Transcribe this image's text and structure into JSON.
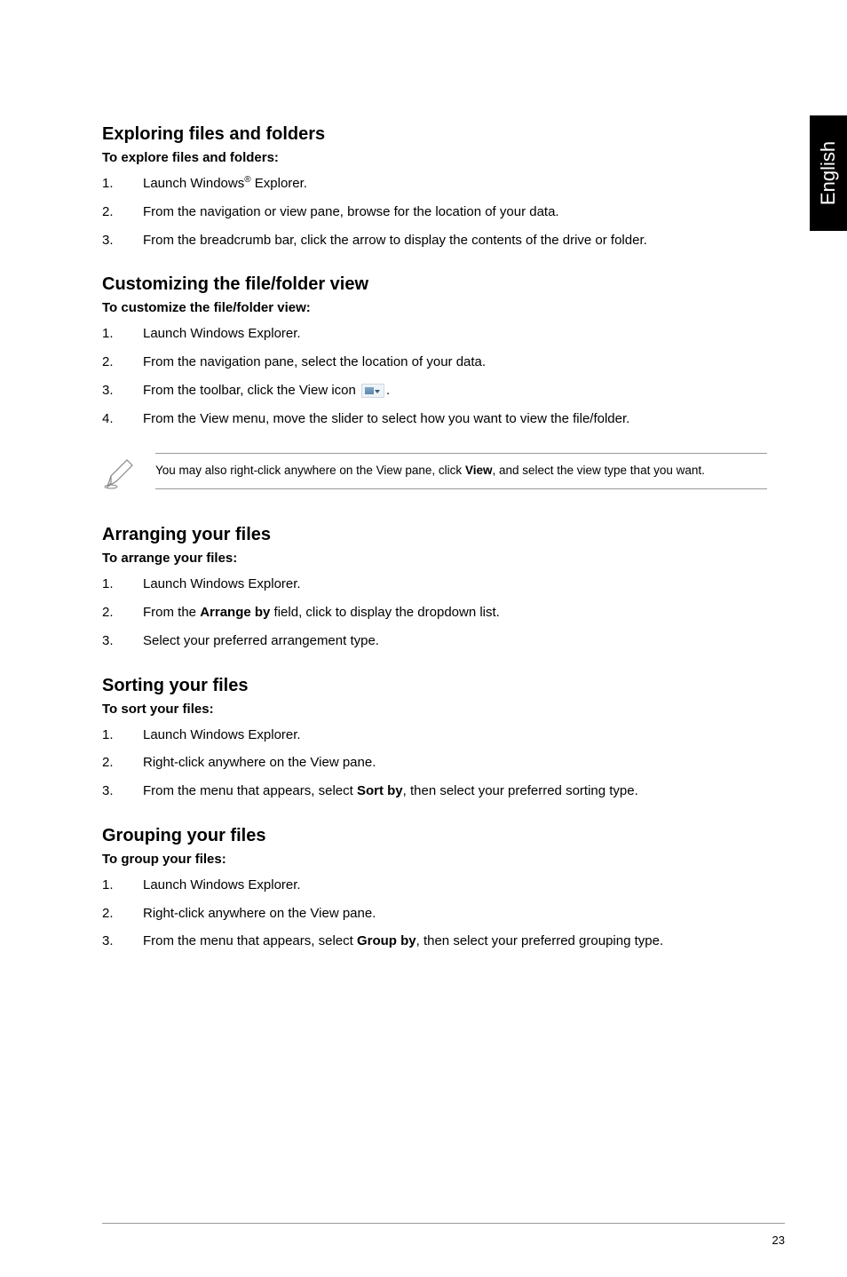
{
  "sideTab": "English",
  "sections": [
    {
      "heading": "Exploring files and folders",
      "subheading": "To explore files and folders:",
      "steps": [
        {
          "num": "1.",
          "pre": "Launch Windows",
          "sup": "®",
          "post": " Explorer."
        },
        {
          "num": "2.",
          "text": "From the navigation or view pane, browse for the location of your data."
        },
        {
          "num": "3.",
          "text": "From the breadcrumb bar, click the arrow to display the contents of the drive or folder."
        }
      ]
    },
    {
      "heading": "Customizing the file/folder view",
      "subheading": "To customize the file/folder view:",
      "steps": [
        {
          "num": "1.",
          "text": "Launch Windows Explorer."
        },
        {
          "num": "2.",
          "text": "From the navigation pane, select the location of your data."
        },
        {
          "num": "3.",
          "textBefore": "From the toolbar, click the View icon ",
          "hasViewIcon": true,
          "textAfter": "."
        },
        {
          "num": "4.",
          "text": "From the View menu, move the slider to select how you want to view the file/folder."
        }
      ],
      "note": {
        "pre": "You may also right-click anywhere on the View pane, click ",
        "bold": "View",
        "post": ", and select the view type that you want."
      }
    },
    {
      "heading": "Arranging your files",
      "subheading": "To arrange your files:",
      "steps": [
        {
          "num": "1.",
          "text": "Launch Windows Explorer."
        },
        {
          "num": "2.",
          "textBefore": "From the ",
          "bold": "Arrange by",
          "textAfter": " field, click to display the dropdown list."
        },
        {
          "num": "3.",
          "text": "Select your preferred arrangement type."
        }
      ]
    },
    {
      "heading": "Sorting your files",
      "subheading": "To sort your files:",
      "steps": [
        {
          "num": "1.",
          "text": "Launch Windows Explorer."
        },
        {
          "num": "2.",
          "text": "Right-click anywhere on the View pane."
        },
        {
          "num": "3.",
          "textBefore": "From the menu that appears, select ",
          "bold": "Sort by",
          "textAfter": ", then select your preferred sorting type."
        }
      ]
    },
    {
      "heading": "Grouping your files",
      "subheading": "To group your files:",
      "steps": [
        {
          "num": "1.",
          "text": "Launch Windows Explorer."
        },
        {
          "num": "2.",
          "text": "Right-click anywhere on the View pane."
        },
        {
          "num": "3.",
          "textBefore": "From the menu that appears, select ",
          "bold": "Group by",
          "textAfter": ", then select your preferred grouping type."
        }
      ]
    }
  ],
  "pageNumber": "23"
}
